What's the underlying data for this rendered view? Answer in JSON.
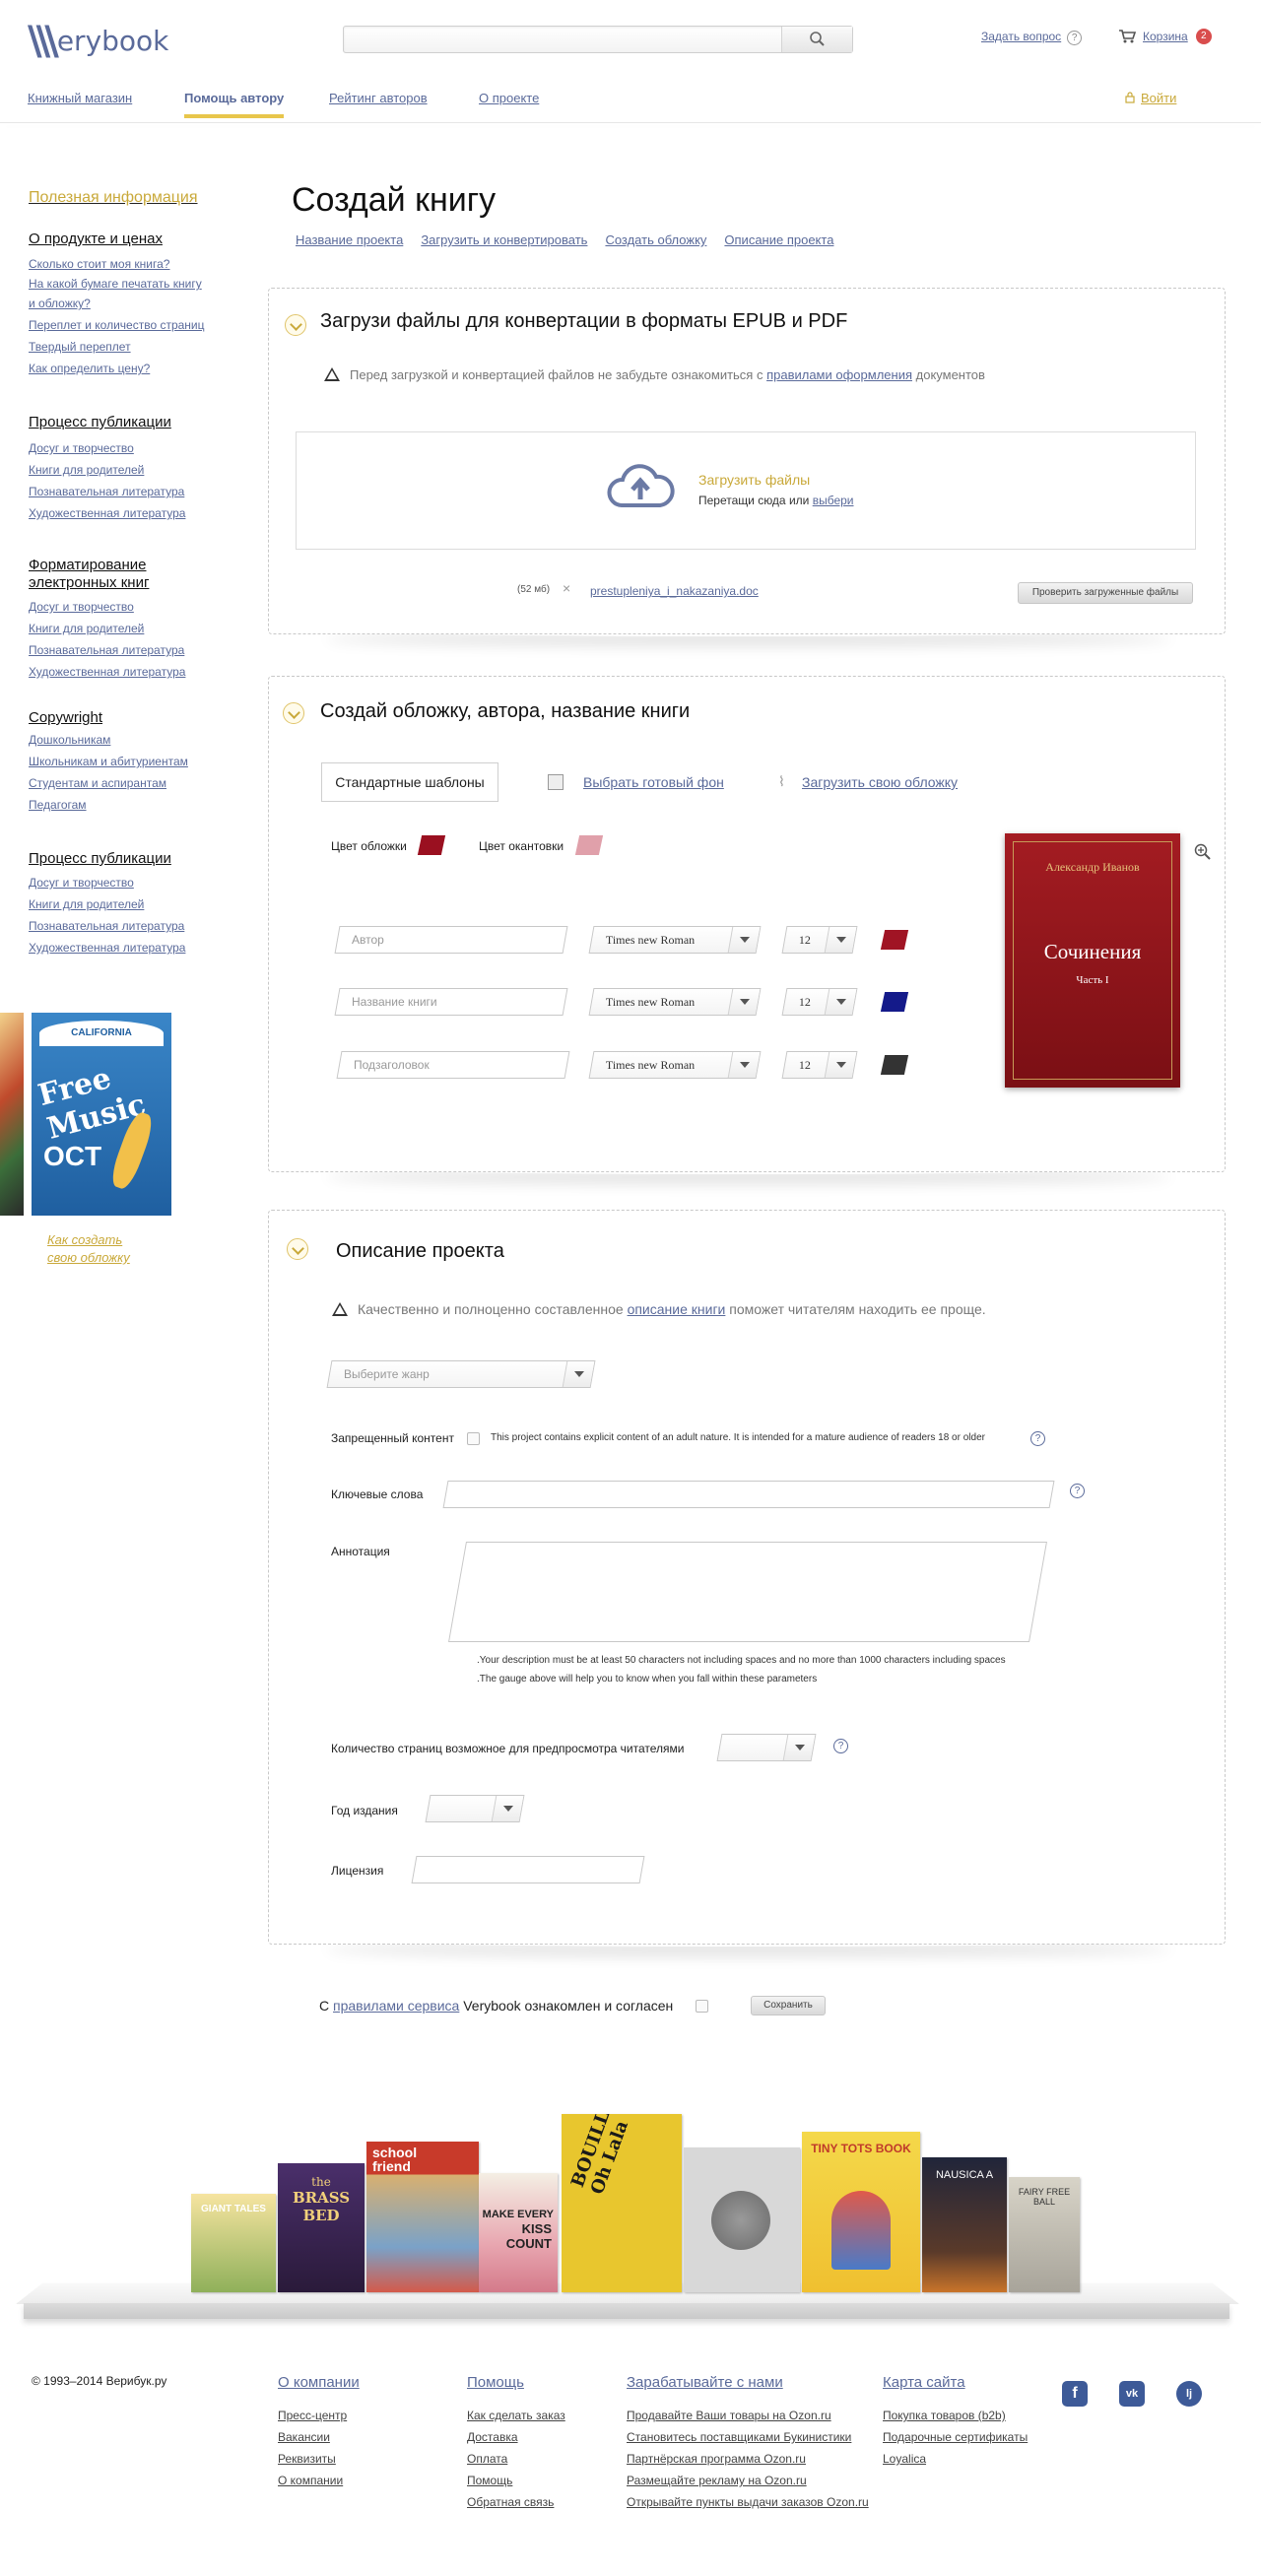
{
  "header": {
    "logo_text": "erybook",
    "search_placeholder": "",
    "ask_label": "Задать вопрос",
    "ask_icon": "?",
    "cart_label": "Корзина",
    "cart_count": "2",
    "login_label": "Войти"
  },
  "nav": [
    {
      "label": "Книжный магазин"
    },
    {
      "label": "Помощь автору",
      "active": true
    },
    {
      "label": "Рейтинг авторов"
    },
    {
      "label": "О проекте"
    }
  ],
  "sidebar": {
    "useful": "Полезная информация",
    "sections": [
      {
        "title": "О продукте и ценах",
        "items": [
          "Сколько стоит моя книга?",
          "На какой бумаге печатать книгу",
          "и обложку?",
          "Переплет и количество страниц",
          "Твердый переплет",
          "Как определить цену?"
        ]
      },
      {
        "title": "Процесс публикации",
        "items": [
          "Досуг и творчество",
          "Книги для родителей",
          "Познавательная литература",
          "Художественная литература"
        ]
      },
      {
        "title_1": "Форматирование",
        "title_2": "электронных книг",
        "items": [
          "Досуг и творчество",
          "Книги для родителей",
          "Познавательная литература",
          "Художественная литература"
        ]
      },
      {
        "title": "Copywright",
        "items": [
          "Дошкольникам",
          "Школьникам и абитуриентам",
          "Студентам и аспирантам",
          "Педагогам"
        ]
      },
      {
        "title": "Процесс публикации",
        "items": [
          "Досуг и творчество",
          "Книги для родителей",
          "Познавательная литература",
          "Художественная литература"
        ]
      }
    ],
    "poster_text": "Free Music",
    "poster_sub": "OCT",
    "poster_top": "CALIFORNIA",
    "howto_1": "Как создать",
    "howto_2": "свою обложку"
  },
  "main": {
    "title": "Создай книгу",
    "steps": [
      "Название проекта",
      "Загрузить и конвертировать",
      "Создать обложку",
      "Описание проекта"
    ]
  },
  "upload_panel": {
    "title": "Загрузи файлы для конвертации в форматы EPUB и PDF",
    "warn_pre": "Перед загрузкой и конвертацией файлов не забудьте ознакомиться с",
    "warn_link": "правилами оформления",
    "warn_post": "документов",
    "upload_title": "Загрузить файлы",
    "drop_text": "Перетащи сюда или",
    "choose_link": "выбери",
    "file_name": "prestupleniya_i_nakazaniya.doc",
    "file_size": "(52 мб)",
    "remove": "×",
    "check_button": "Проверить загруженные файлы"
  },
  "cover_panel": {
    "title": "Создай обложку, автора, название книги",
    "tab_templates": "Стандартные шаблоны",
    "tab_background": "Выбрать готовый фон",
    "tab_upload": "Загрузить свою обложку",
    "cover_color_label": "Цвет обложки",
    "edge_color_label": "Цвет окантовки",
    "cover_color": "#9a1020",
    "edge_color": "#e0a0aa",
    "rows": [
      {
        "placeholder": "Автор",
        "font": "Times new Roman",
        "size": "12",
        "color": "#a01424"
      },
      {
        "placeholder": "Название книги",
        "font": "Times new Roman",
        "size": "12",
        "color": "#141a8a"
      },
      {
        "placeholder": "Подзаголовок",
        "font": "Times new Roman",
        "size": "12",
        "color": "#333333"
      }
    ],
    "preview_author": "Александр Иванов",
    "preview_title": "Сочинения",
    "preview_part": "Часть I"
  },
  "description_panel": {
    "title": "Описание проекта",
    "warn_pre": "Качественно и полноценно составленное",
    "warn_link": "описание книги",
    "warn_post": "поможет читателям находить ее проще.",
    "genre_placeholder": "Выберите жанр",
    "adult_label": "Запрещенный контент",
    "adult_text": "This project contains explicit content of an adult nature. It is intended for a mature audience of readers 18 or older",
    "keywords_label": "Ключевые слова",
    "annotation_label": "Аннотация",
    "hint_1": ".Your description must be at least 50 characters not including spaces and no more than 1000 characters including spaces",
    "hint_2": ".The gauge above will help you to know when you fall within these parameters",
    "pages_label": "Количество страниц возможное для предпросмотра читателями",
    "year_label": "Год издания",
    "license_label": "Лицензия"
  },
  "agree": {
    "pre": "С",
    "link": "правилами сервиса",
    "post": "Verybook ознакомлен и согласен",
    "save_button": "Сохранить"
  },
  "books": {
    "b1": "GIANT TALES",
    "b2a": "the",
    "b2b": "BRASS BED",
    "b3a": "school",
    "b3b": "friend",
    "b4a": "MAKE EVERY",
    "b4b": "KISS",
    "b4c": "COUNT",
    "b5": "BOUILLON! Oh Lala",
    "b7": "TINY TOTS BOOK",
    "b8": "NAUSICA A",
    "b9": "FAIRY FREE BALL"
  },
  "footer": {
    "copyright": "© 1993–2014 Верибук.ру",
    "columns": [
      {
        "title": "О компании",
        "links": [
          "Пресс-центр",
          "Вакансии",
          "Реквизиты",
          "О компании"
        ]
      },
      {
        "title": "Помощь",
        "links": [
          "Как сделать заказ",
          "Доставка",
          "Оплата",
          "Помощь",
          "Обратная связь"
        ]
      },
      {
        "title": "Зарабатывайте с нами",
        "links": [
          "Продавайте Ваши товары на Ozon.ru",
          "Становитесь поставщиками Букинистики",
          "Партнёрская программа Ozon.ru",
          "Размещайте рекламу на Ozon.ru",
          "Открывайте пункты выдачи заказов Ozon.ru"
        ]
      },
      {
        "title": "Карта сайта",
        "links": [
          "Покупка товаров (b2b)",
          "Подарочные сертификаты",
          "Loyalica"
        ]
      }
    ],
    "social": [
      "f",
      "vk",
      "lj"
    ]
  }
}
